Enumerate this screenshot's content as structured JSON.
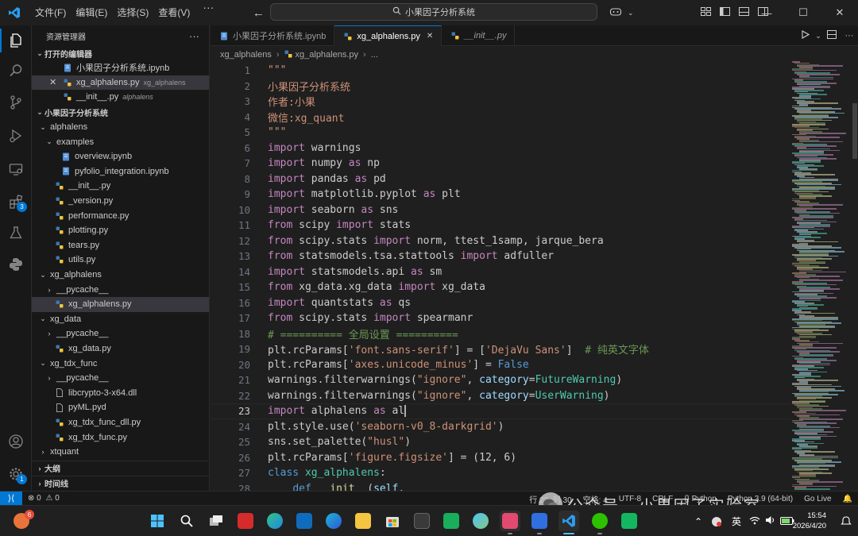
{
  "titlebar": {
    "menus": [
      "文件(F)",
      "编辑(E)",
      "选择(S)",
      "查看(V)"
    ],
    "more": "···",
    "search": "小果因子分析系统"
  },
  "activity_badges": {
    "extensions": "3",
    "settings": "1"
  },
  "sidebar": {
    "title": "资源管理器",
    "more": "···",
    "open_editors_header": "打开的编辑器",
    "open_editors": [
      {
        "name": "小果因子分析系统.ipynb",
        "desc": ""
      },
      {
        "name": "xg_alphalens.py",
        "desc": "xg_alphalens"
      },
      {
        "name": "__init__.py",
        "desc": "alphalens"
      }
    ],
    "project_header": "小果因子分析系统",
    "tree": [
      {
        "name": "alphalens",
        "type": "folder-open",
        "indent": 0
      },
      {
        "name": "examples",
        "type": "folder-open",
        "indent": 1
      },
      {
        "name": "overview.ipynb",
        "type": "nb",
        "indent": 2
      },
      {
        "name": "pyfolio_integration.ipynb",
        "type": "nb",
        "indent": 2
      },
      {
        "name": "__init__.py",
        "type": "py",
        "indent": 1
      },
      {
        "name": "_version.py",
        "type": "py",
        "indent": 1
      },
      {
        "name": "performance.py",
        "type": "py",
        "indent": 1
      },
      {
        "name": "plotting.py",
        "type": "py",
        "indent": 1
      },
      {
        "name": "tears.py",
        "type": "py",
        "indent": 1
      },
      {
        "name": "utils.py",
        "type": "py",
        "indent": 1
      },
      {
        "name": "xg_alphalens",
        "type": "folder-open",
        "indent": 0
      },
      {
        "name": "__pycache__",
        "type": "folder",
        "indent": 1
      },
      {
        "name": "xg_alphalens.py",
        "type": "py",
        "indent": 1,
        "selected": true
      },
      {
        "name": "xg_data",
        "type": "folder-open",
        "indent": 0
      },
      {
        "name": "__pycache__",
        "type": "folder",
        "indent": 1
      },
      {
        "name": "xg_data.py",
        "type": "py",
        "indent": 1
      },
      {
        "name": "xg_tdx_func",
        "type": "folder-open",
        "indent": 0
      },
      {
        "name": "__pycache__",
        "type": "folder",
        "indent": 1
      },
      {
        "name": "libcrypto-3-x64.dll",
        "type": "file",
        "indent": 1
      },
      {
        "name": "pyML.pyd",
        "type": "file",
        "indent": 1
      },
      {
        "name": "xg_tdx_func_dll.py",
        "type": "py",
        "indent": 1
      },
      {
        "name": "xg_tdx_func.py",
        "type": "py",
        "indent": 1
      },
      {
        "name": "xtquant",
        "type": "folder",
        "indent": 0
      }
    ],
    "outline_header": "大纲",
    "timeline_header": "时间线"
  },
  "tabs": [
    {
      "label": "小果因子分析系统.ipynb",
      "kind": "nb",
      "active": false,
      "italic": false
    },
    {
      "label": "xg_alphalens.py",
      "kind": "py",
      "active": true,
      "italic": false
    },
    {
      "label": "__init__.py",
      "kind": "py",
      "active": false,
      "italic": true
    }
  ],
  "breadcrumb": [
    "xg_alphalens",
    "xg_alphalens.py",
    "..."
  ],
  "editor": {
    "current_line": 23,
    "lines": [
      [
        [
          "str",
          "\"\"\""
        ]
      ],
      [
        [
          "str",
          "小果因子分析系统"
        ]
      ],
      [
        [
          "str",
          "作者:小果"
        ]
      ],
      [
        [
          "str",
          "微信:xg_quant"
        ]
      ],
      [
        [
          "str",
          "\"\"\""
        ]
      ],
      [
        [
          "kw",
          "import"
        ],
        [
          "def",
          " warnings"
        ]
      ],
      [
        [
          "kw",
          "import"
        ],
        [
          "def",
          " numpy "
        ],
        [
          "kw",
          "as"
        ],
        [
          "def",
          " np"
        ]
      ],
      [
        [
          "kw",
          "import"
        ],
        [
          "def",
          " pandas "
        ],
        [
          "kw",
          "as"
        ],
        [
          "def",
          " pd"
        ]
      ],
      [
        [
          "kw",
          "import"
        ],
        [
          "def",
          " matplotlib.pyplot "
        ],
        [
          "kw",
          "as"
        ],
        [
          "def",
          " plt"
        ]
      ],
      [
        [
          "kw",
          "import"
        ],
        [
          "def",
          " seaborn "
        ],
        [
          "kw",
          "as"
        ],
        [
          "def",
          " sns"
        ]
      ],
      [
        [
          "kw",
          "from"
        ],
        [
          "def",
          " scipy "
        ],
        [
          "kw",
          "import"
        ],
        [
          "def",
          " stats"
        ]
      ],
      [
        [
          "kw",
          "from"
        ],
        [
          "def",
          " scipy.stats "
        ],
        [
          "kw",
          "import"
        ],
        [
          "def",
          " norm, ttest_1samp, jarque_bera"
        ]
      ],
      [
        [
          "kw",
          "from"
        ],
        [
          "def",
          " statsmodels.tsa.stattools "
        ],
        [
          "kw",
          "import"
        ],
        [
          "def",
          " adfuller"
        ]
      ],
      [
        [
          "kw",
          "import"
        ],
        [
          "def",
          " statsmodels.api "
        ],
        [
          "kw",
          "as"
        ],
        [
          "def",
          " sm"
        ]
      ],
      [
        [
          "kw",
          "from"
        ],
        [
          "def",
          " xg_data.xg_data "
        ],
        [
          "kw",
          "import"
        ],
        [
          "def",
          " xg_data"
        ]
      ],
      [
        [
          "kw",
          "import"
        ],
        [
          "def",
          " quantstats "
        ],
        [
          "kw",
          "as"
        ],
        [
          "def",
          " qs"
        ]
      ],
      [
        [
          "kw",
          "from"
        ],
        [
          "def",
          " scipy.stats "
        ],
        [
          "kw",
          "import"
        ],
        [
          "def",
          " spearmanr"
        ]
      ],
      [
        [
          "com",
          "# ========== 全局设置 =========="
        ]
      ],
      [
        [
          "def",
          "plt.rcParams["
        ],
        [
          "str",
          "'font.sans-serif'"
        ],
        [
          "def",
          "] = ["
        ],
        [
          "str",
          "'DejaVu Sans'"
        ],
        [
          "def",
          "]  "
        ],
        [
          "com",
          "# 纯英文字体"
        ]
      ],
      [
        [
          "def",
          "plt.rcParams["
        ],
        [
          "str",
          "'axes.unicode_minus'"
        ],
        [
          "def",
          "] = "
        ],
        [
          "kw2",
          "False"
        ]
      ],
      [
        [
          "def",
          "warnings.filterwarnings("
        ],
        [
          "str",
          "\"ignore\""
        ],
        [
          "def",
          ", "
        ],
        [
          "param",
          "category"
        ],
        [
          "def",
          "="
        ],
        [
          "cls",
          "FutureWarning"
        ],
        [
          "def",
          ")"
        ]
      ],
      [
        [
          "def",
          "warnings.filterwarnings("
        ],
        [
          "str",
          "\"ignore\""
        ],
        [
          "def",
          ", "
        ],
        [
          "param",
          "category"
        ],
        [
          "def",
          "="
        ],
        [
          "cls",
          "UserWarning"
        ],
        [
          "def",
          ")"
        ]
      ],
      [
        [
          "kw",
          "import"
        ],
        [
          "def",
          " alphalens "
        ],
        [
          "kw",
          "as"
        ],
        [
          "def",
          " al"
        ],
        [
          "cursor",
          ""
        ]
      ],
      [
        [
          "def",
          "plt.style.use("
        ],
        [
          "str",
          "'seaborn-v0_8-darkgrid'"
        ],
        [
          "def",
          ")"
        ]
      ],
      [
        [
          "def",
          "sns.set_palette("
        ],
        [
          "str",
          "\"husl\""
        ],
        [
          "def",
          ")"
        ]
      ],
      [
        [
          "def",
          "plt.rcParams["
        ],
        [
          "str",
          "'figure.figsize'"
        ],
        [
          "def",
          "] = (12, 6)"
        ]
      ],
      [
        [
          "kw2",
          "class"
        ],
        [
          "def",
          " "
        ],
        [
          "cls",
          "xg_alphalens"
        ],
        [
          "def",
          ":"
        ]
      ],
      [
        [
          "def",
          "    "
        ],
        [
          "kw2",
          "def"
        ],
        [
          "def",
          " "
        ],
        [
          "fn",
          "__init__"
        ],
        [
          "def",
          "("
        ],
        [
          "param",
          "self"
        ],
        [
          "def",
          ","
        ]
      ]
    ]
  },
  "statusbar": {
    "errors": "0",
    "warnings": "0",
    "position": "行 23, 列 30",
    "spaces": "空格: 4",
    "encoding": "UTF-8",
    "eol": "CRLF",
    "language": "{} Python",
    "interpreter": "Python 3.9 (64-bit)",
    "golive": "Go Live"
  },
  "watermark": "公众号 · 小果因子实验室",
  "taskbar": {
    "badge": "6",
    "tray_lang": "英",
    "time": "15:54",
    "date": "2026/4/20"
  },
  "colors": {
    "accent": "#0078d4",
    "keyword": "#c586c0",
    "string": "#ce9178",
    "comment": "#6a9955",
    "class": "#4ec9b0"
  }
}
